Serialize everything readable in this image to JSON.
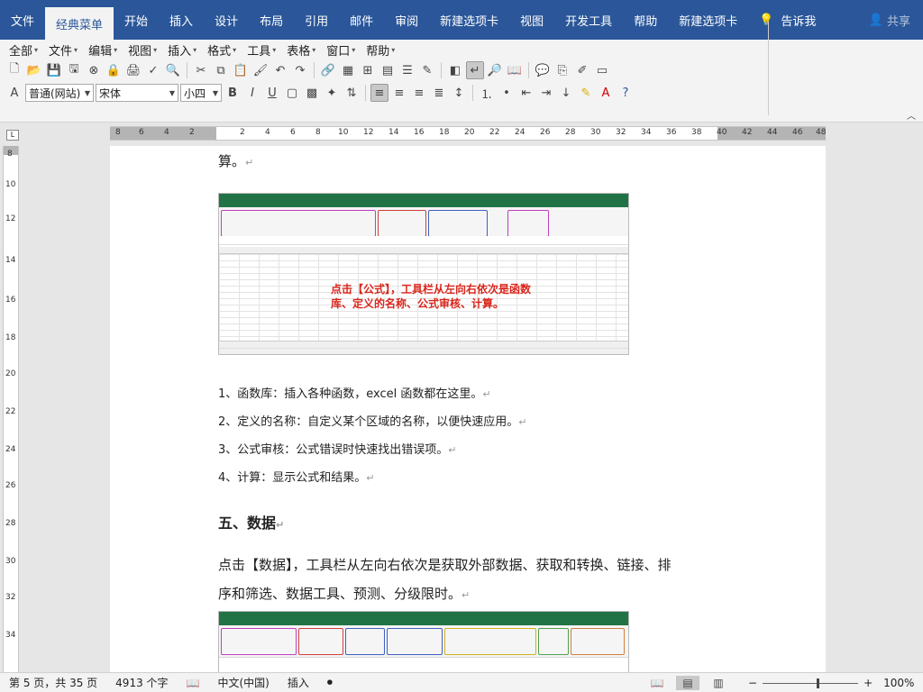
{
  "ribbon": {
    "tabs": [
      "文件",
      "经典菜单",
      "开始",
      "插入",
      "设计",
      "布局",
      "引用",
      "邮件",
      "审阅",
      "新建选项卡",
      "视图",
      "开发工具",
      "帮助",
      "新建选项卡"
    ],
    "active_tab": "经典菜单",
    "tell_me": "告诉我",
    "share": "共享"
  },
  "menubar": [
    "全部",
    "文件",
    "编辑",
    "视图",
    "插入",
    "格式",
    "工具",
    "表格",
    "窗口",
    "帮助"
  ],
  "format_toolbar": {
    "style": "普通(网站)",
    "font": "宋体",
    "size": "小四"
  },
  "ruler": {
    "h_ticks": [
      "8",
      "6",
      "4",
      "2",
      "2",
      "4",
      "6",
      "8",
      "10",
      "12",
      "14",
      "16",
      "18",
      "20",
      "22",
      "24",
      "26",
      "28",
      "30",
      "32",
      "34",
      "36",
      "38",
      "40",
      "42",
      "44",
      "46",
      "48"
    ],
    "v_ticks": [
      "8",
      "10",
      "12",
      "14",
      "16",
      "18",
      "20",
      "22",
      "24",
      "26",
      "28",
      "30",
      "32",
      "34"
    ]
  },
  "document": {
    "line_top": "算。",
    "callout_line1": "点击【公式】，工具栏从左向右依次是函数",
    "callout_line2": "库、定义的名称、公式审核、计算。",
    "items": [
      "1、函数库：插入各种函数，excel 函数都在这里。",
      "2、定义的名称：自定义某个区域的名称，以便快速应用。",
      "3、公式审核：公式错误时快速找出错误项。",
      "4、计算：显示公式和结果。"
    ],
    "heading": "五、数据",
    "body_line1": "点击【数据】，工具栏从左向右依次是获取外部数据、获取和转换、链接、排",
    "body_line2": "序和筛选、数据工具、预测、分级限时。",
    "para_mark": "↵"
  },
  "statusbar": {
    "page": "第 5 页，共 35 页",
    "words": "4913 个字",
    "language": "中文(中国)",
    "mode": "插入",
    "zoom": "100%"
  },
  "colors": {
    "ribbon_blue": "#2b579a",
    "excel_green": "#217346",
    "callout_red": "#d9261c",
    "group_magenta": "#c040c0",
    "group_red": "#d04040",
    "group_blue": "#4060c0",
    "group_yellow": "#d0b020",
    "group_green": "#50a050"
  }
}
